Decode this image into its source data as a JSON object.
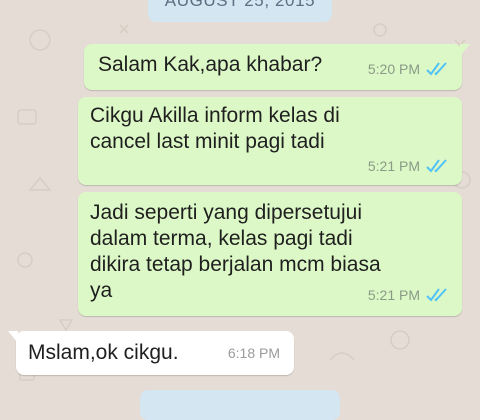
{
  "date_chip": "AUGUST 25, 2015",
  "colors": {
    "wallpaper": "#e5ddd5",
    "outgoing_bubble": "#dcf8c6",
    "incoming_bubble": "#ffffff",
    "read_tick": "#4fc3f7",
    "date_chip": "#d5e6f3"
  },
  "messages": [
    {
      "direction": "outgoing",
      "text": "Salam Kak,apa khabar?",
      "time": "5:20 PM",
      "status_icon": "double-check-read-icon"
    },
    {
      "direction": "outgoing",
      "lines": [
        "Cikgu Akilla inform kelas di",
        "cancel last minit pagi tadi"
      ],
      "time": "5:21 PM",
      "status_icon": "double-check-read-icon"
    },
    {
      "direction": "outgoing",
      "lines": [
        "Jadi seperti yang dipersetujui",
        "dalam terma, kelas pagi tadi",
        "dikira tetap berjalan mcm biasa",
        "ya"
      ],
      "time": "5:21 PM",
      "status_icon": "double-check-read-icon"
    },
    {
      "direction": "incoming",
      "text": "Mslam,ok cikgu.",
      "time": "6:18 PM"
    }
  ]
}
